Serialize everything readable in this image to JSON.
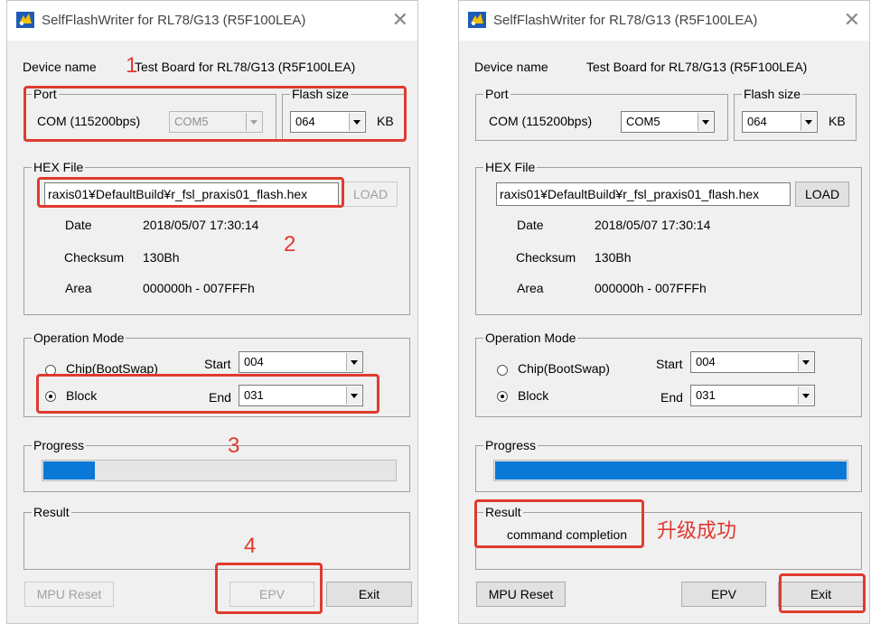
{
  "colors": {
    "annotation": "#e03a2f",
    "progress_fill": "#0a78d7"
  },
  "left": {
    "title": "SelfFlashWriter for RL78/G13 (R5F100LEA)",
    "close_glyph": "✕",
    "device_label": "Device name",
    "device_value": "Test Board for RL78/G13 (R5F100LEA)",
    "port_legend": "Port",
    "port_label": "COM (115200bps)",
    "port_select": "COM5",
    "flash_legend": "Flash size",
    "flash_select": "064",
    "flash_unit": "KB",
    "hex_legend": "HEX File",
    "hex_path": "raxis01¥DefaultBuild¥r_fsl_praxis01_flash.hex",
    "load_label": "LOAD",
    "date_label": "Date",
    "date_value": "2018/05/07 17:30:14",
    "checksum_label": "Checksum",
    "checksum_value": "130Bh",
    "area_label": "Area",
    "area_value": "000000h - 007FFFh",
    "op_legend": "Operation Mode",
    "chip_label": "Chip(BootSwap)",
    "block_label": "Block",
    "start_label": "Start",
    "start_value": "004",
    "end_label": "End",
    "end_value": "031",
    "progress_legend": "Progress",
    "progress": 0.15,
    "result_legend": "Result",
    "result_text": "",
    "mpu_reset_label": "MPU Reset",
    "epv_label": "EPV",
    "exit_label": "Exit",
    "annotations": {
      "n1": "1",
      "n2": "2",
      "n3": "3",
      "n4": "4"
    }
  },
  "right": {
    "title": "SelfFlashWriter for RL78/G13 (R5F100LEA)",
    "close_glyph": "✕",
    "device_label": "Device name",
    "device_value": "Test Board for RL78/G13 (R5F100LEA)",
    "port_legend": "Port",
    "port_label": "COM (115200bps)",
    "port_select": "COM5",
    "flash_legend": "Flash size",
    "flash_select": "064",
    "flash_unit": "KB",
    "hex_legend": "HEX File",
    "hex_path": "raxis01¥DefaultBuild¥r_fsl_praxis01_flash.hex",
    "load_label": "LOAD",
    "date_label": "Date",
    "date_value": "2018/05/07 17:30:14",
    "checksum_label": "Checksum",
    "checksum_value": "130Bh",
    "area_label": "Area",
    "area_value": "000000h - 007FFFh",
    "op_legend": "Operation Mode",
    "chip_label": "Chip(BootSwap)",
    "block_label": "Block",
    "start_label": "Start",
    "start_value": "004",
    "end_label": "End",
    "end_value": "031",
    "progress_legend": "Progress",
    "progress": 1.0,
    "result_legend": "Result",
    "result_text": "command completion",
    "mpu_reset_label": "MPU Reset",
    "epv_label": "EPV",
    "exit_label": "Exit",
    "annotation_success": "升级成功"
  }
}
